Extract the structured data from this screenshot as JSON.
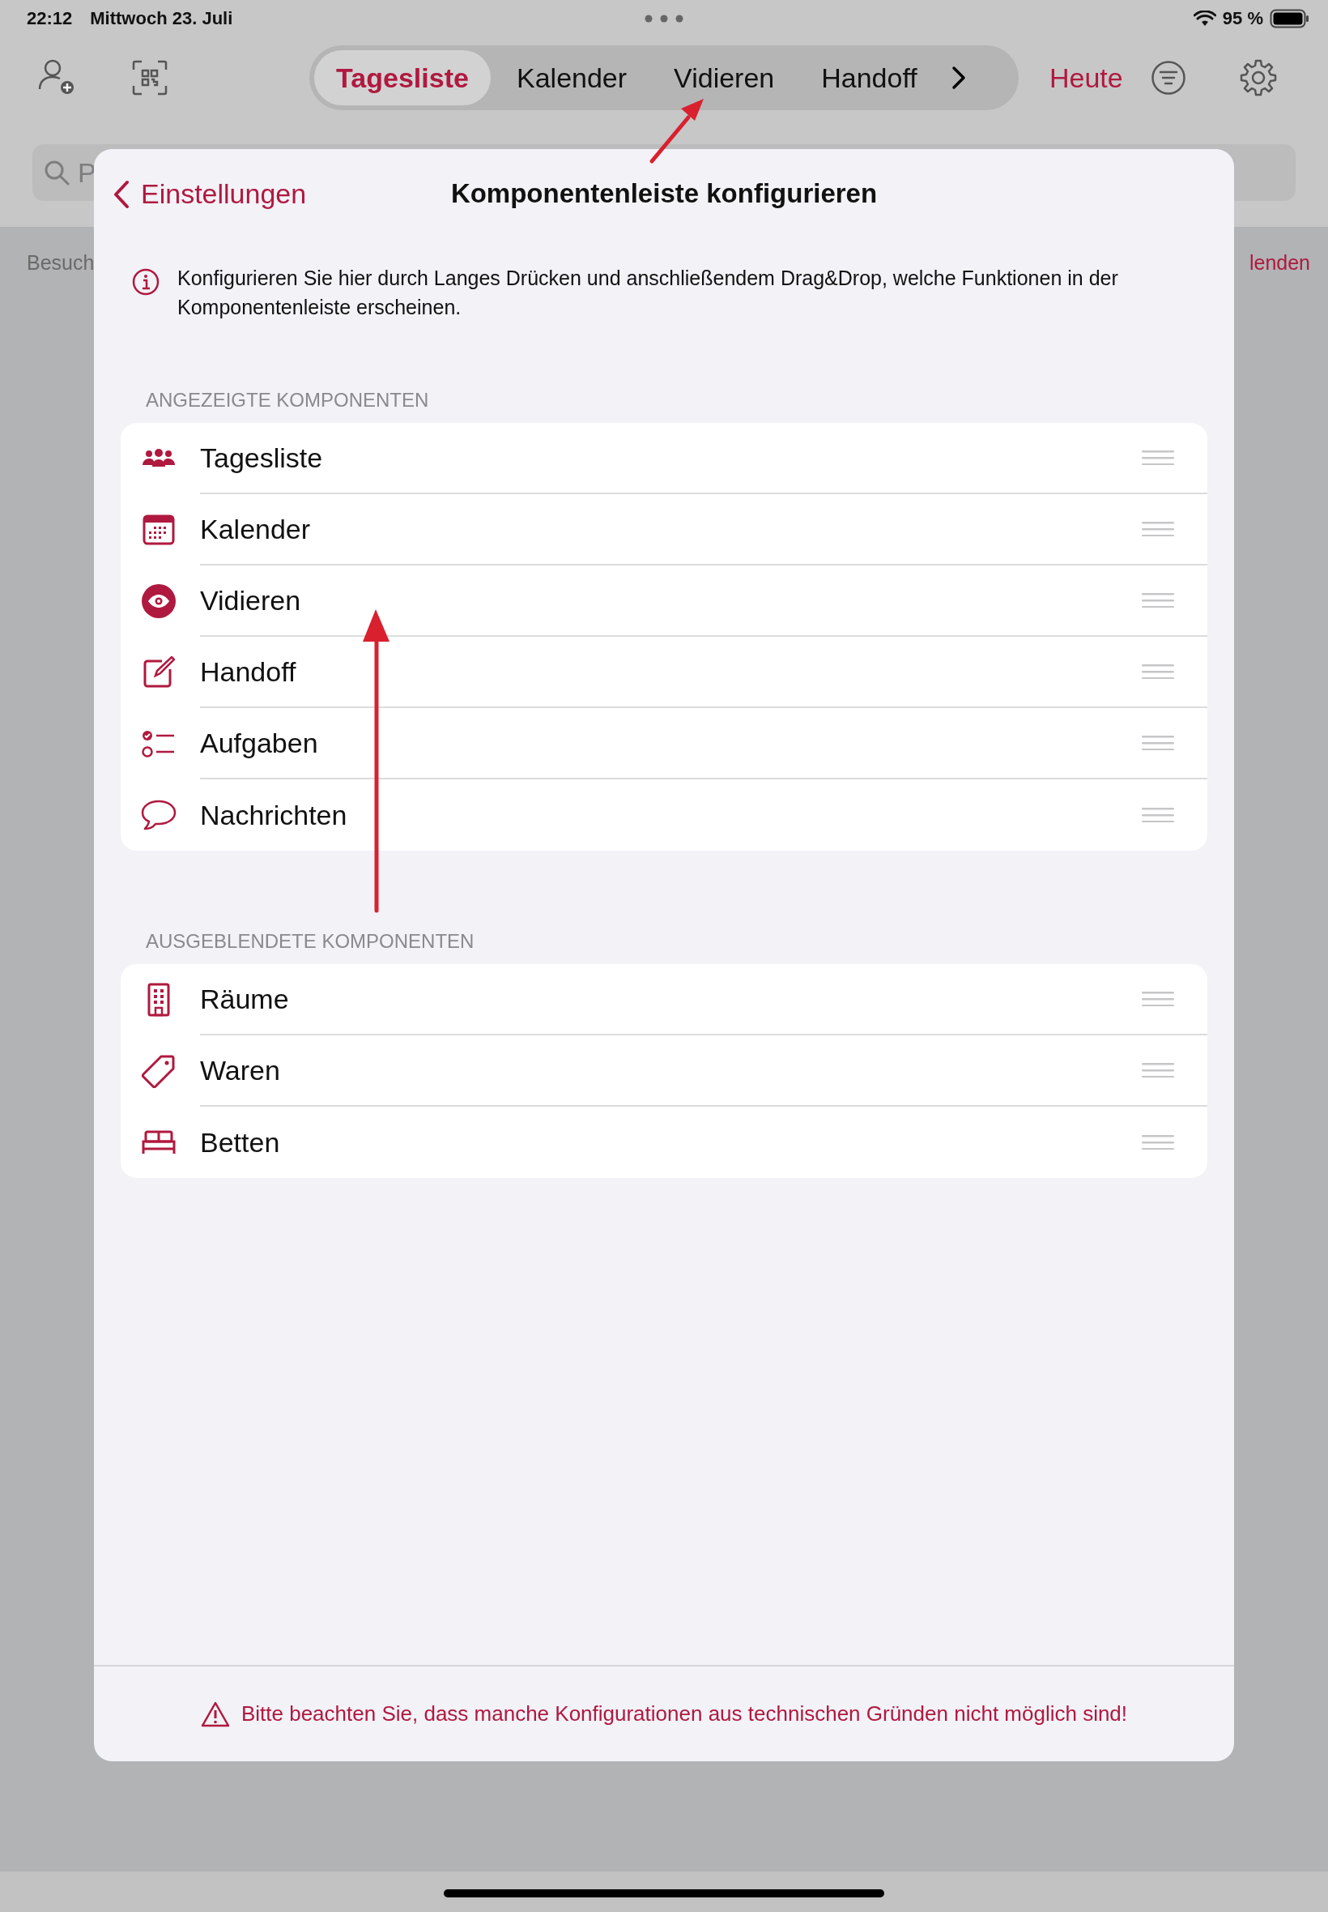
{
  "status_bar": {
    "time": "22:12",
    "date": "Mittwoch 23. Juli",
    "battery": "95 %"
  },
  "toolbar": {
    "tabs": [
      {
        "label": "Tagesliste",
        "selected": true
      },
      {
        "label": "Kalender",
        "selected": false
      },
      {
        "label": "Vidieren",
        "selected": false
      },
      {
        "label": "Handoff",
        "selected": false
      }
    ],
    "today": "Heute"
  },
  "search": {
    "placeholder": "P"
  },
  "background_row": {
    "left": "Besuch",
    "right": "lenden"
  },
  "sheet": {
    "back": "Einstellungen",
    "title": "Komponentenleiste konfigurieren",
    "info": "Konfigurieren Sie hier durch Langes Drücken und anschließendem Drag&Drop, welche Funktionen in der Komponentenleiste erscheinen.",
    "sections": [
      {
        "header": "ANGEZEIGTE KOMPONENTEN",
        "items": [
          {
            "label": "Tagesliste",
            "kind": "people"
          },
          {
            "label": "Kalender",
            "kind": "calendar"
          },
          {
            "label": "Vidieren",
            "kind": "eye"
          },
          {
            "label": "Handoff",
            "kind": "edit"
          },
          {
            "label": "Aufgaben",
            "kind": "checklist"
          },
          {
            "label": "Nachrichten",
            "kind": "bubble"
          }
        ]
      },
      {
        "header": "AUSGEBLENDETE KOMPONENTEN",
        "items": [
          {
            "label": "Räume",
            "kind": "building"
          },
          {
            "label": "Waren",
            "kind": "tag"
          },
          {
            "label": "Betten",
            "kind": "bed"
          }
        ]
      }
    ],
    "warning": "Bitte beachten Sie, dass manche Konfigurationen aus technischen Gründen nicht möglich sind!"
  }
}
